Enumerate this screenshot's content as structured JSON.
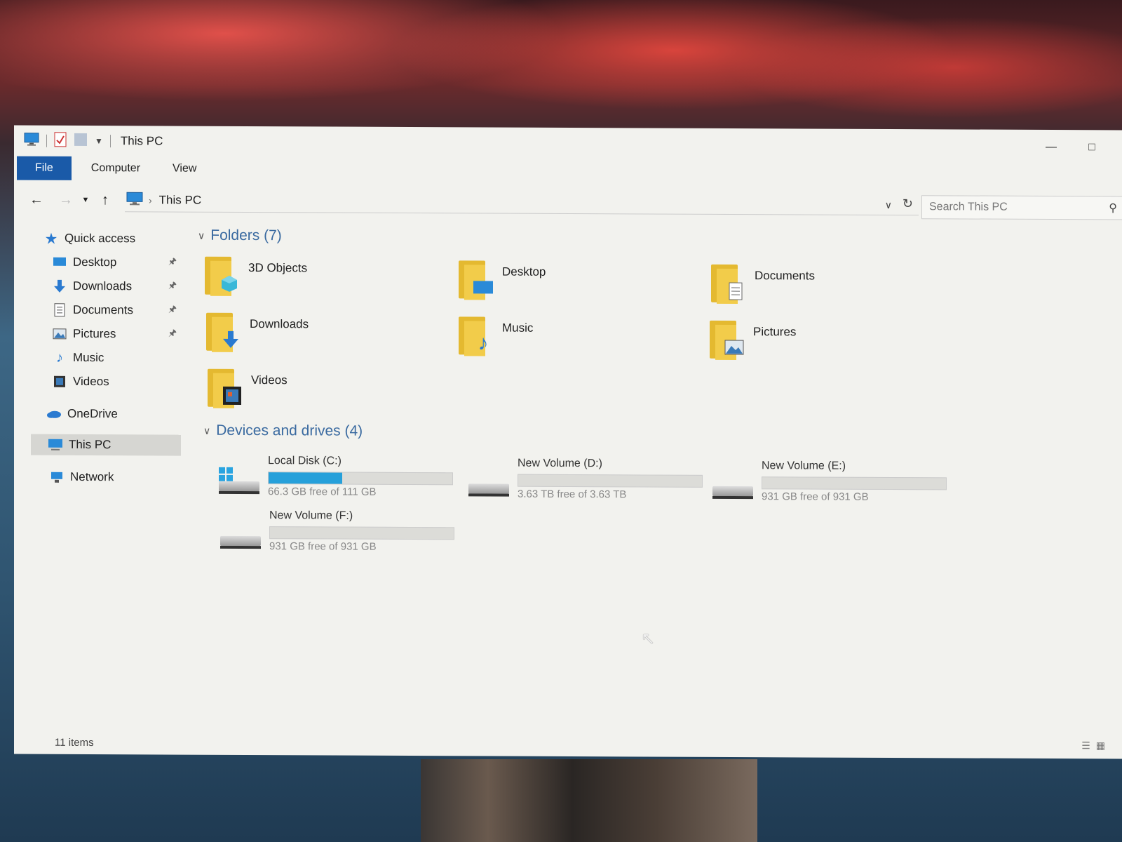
{
  "window": {
    "title": "This PC",
    "qat_icons": [
      "this-pc-icon",
      "properties-icon",
      "new-folder-icon",
      "customize-qat-icon"
    ]
  },
  "ribbon": {
    "tabs": [
      {
        "label": "File",
        "active": true
      },
      {
        "label": "Computer"
      },
      {
        "label": "View"
      }
    ],
    "file_color": "#1a5aa8"
  },
  "address": {
    "crumb": "This PC",
    "search_placeholder": "Search This PC"
  },
  "sidebar": {
    "items": [
      {
        "label": "Quick access",
        "icon": "star-icon"
      },
      {
        "label": "Desktop",
        "icon": "desktop-icon",
        "pinned": true
      },
      {
        "label": "Downloads",
        "icon": "download-icon",
        "pinned": true
      },
      {
        "label": "Documents",
        "icon": "document-icon",
        "pinned": true
      },
      {
        "label": "Pictures",
        "icon": "picture-icon",
        "pinned": true
      },
      {
        "label": "Music",
        "icon": "music-icon"
      },
      {
        "label": "Videos",
        "icon": "video-icon"
      },
      {
        "label": "OneDrive",
        "icon": "cloud-icon"
      },
      {
        "label": "This PC",
        "icon": "computer-icon",
        "selected": true
      },
      {
        "label": "Network",
        "icon": "network-icon"
      }
    ]
  },
  "folders": {
    "header": "Folders (7)",
    "items": [
      {
        "label": "3D Objects",
        "icon": "cube-icon"
      },
      {
        "label": "Desktop",
        "icon": "desktop-icon"
      },
      {
        "label": "Documents",
        "icon": "document-icon"
      },
      {
        "label": "Downloads",
        "icon": "download-icon"
      },
      {
        "label": "Music",
        "icon": "music-icon"
      },
      {
        "label": "Pictures",
        "icon": "picture-icon"
      },
      {
        "label": "Videos",
        "icon": "video-icon"
      }
    ]
  },
  "drives": {
    "header": "Devices and drives (4)",
    "items": [
      {
        "name": "Local Disk (C:)",
        "free": "66.3 GB free of 111 GB",
        "used_fraction": 0.4,
        "system": true
      },
      {
        "name": "New Volume (D:)",
        "free": "3.63 TB free of 3.63 TB",
        "used_fraction": 0.0
      },
      {
        "name": "New Volume (E:)",
        "free": "931 GB free of 931 GB",
        "used_fraction": 0.0
      },
      {
        "name": "New Volume (F:)",
        "free": "931 GB free of 931 GB",
        "used_fraction": 0.0
      }
    ],
    "bar_color": "#26a0da"
  },
  "status": {
    "items_count": "11 items"
  }
}
